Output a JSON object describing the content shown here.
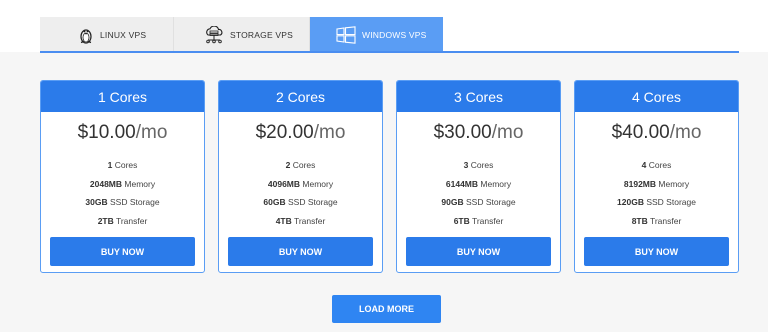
{
  "tabs": [
    {
      "label": "LINUX VPS",
      "icon": "penguin-icon",
      "active": false
    },
    {
      "label": "STORAGE VPS",
      "icon": "cloud-server-icon",
      "active": false
    },
    {
      "label": "WINDOWS VPS",
      "icon": "windows-logo-icon",
      "active": true
    }
  ],
  "colors": {
    "accent": "#2b7bea",
    "active_tab": "#5a9df4",
    "background": "#f6f6f6"
  },
  "plans": [
    {
      "title": "1 Cores",
      "price": "$10.00",
      "period": "/mo",
      "cores": {
        "value": "1",
        "label": "Cores"
      },
      "memory": {
        "value": "2048MB",
        "label": "Memory"
      },
      "storage": {
        "value": "30GB",
        "label": "SSD Storage"
      },
      "transfer": {
        "value": "2TB",
        "label": "Transfer"
      },
      "button": "BUY NOW"
    },
    {
      "title": "2 Cores",
      "price": "$20.00",
      "period": "/mo",
      "cores": {
        "value": "2",
        "label": "Cores"
      },
      "memory": {
        "value": "4096MB",
        "label": "Memory"
      },
      "storage": {
        "value": "60GB",
        "label": "SSD Storage"
      },
      "transfer": {
        "value": "4TB",
        "label": "Transfer"
      },
      "button": "BUY NOW"
    },
    {
      "title": "3 Cores",
      "price": "$30.00",
      "period": "/mo",
      "cores": {
        "value": "3",
        "label": "Cores"
      },
      "memory": {
        "value": "6144MB",
        "label": "Memory"
      },
      "storage": {
        "value": "90GB",
        "label": "SSD Storage"
      },
      "transfer": {
        "value": "6TB",
        "label": "Transfer"
      },
      "button": "BUY NOW"
    },
    {
      "title": "4 Cores",
      "price": "$40.00",
      "period": "/mo",
      "cores": {
        "value": "4",
        "label": "Cores"
      },
      "memory": {
        "value": "8192MB",
        "label": "Memory"
      },
      "storage": {
        "value": "120GB",
        "label": "SSD Storage"
      },
      "transfer": {
        "value": "8TB",
        "label": "Transfer"
      },
      "button": "BUY NOW"
    }
  ],
  "load_more": "LOAD MORE"
}
